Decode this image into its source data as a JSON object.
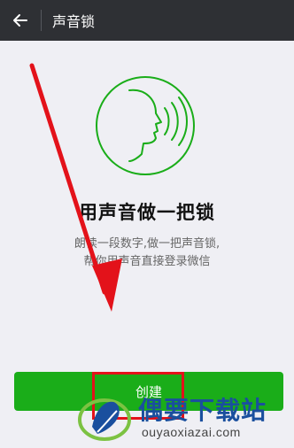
{
  "header": {
    "title": "声音锁",
    "back_icon": "arrow-left-icon"
  },
  "main": {
    "illustration_icon": "voice-face-icon",
    "heading": "用声音做一把锁",
    "description_line1": "朗读一段数字,做一把声音锁,",
    "description_line2": "帮你用声音直接登录微信",
    "create_button_label": "创建"
  },
  "watermark": {
    "brand": "偶要下载站",
    "url": "ouyaoxiazai.com"
  },
  "colors": {
    "topbar": "#2e3034",
    "background": "#efeff4",
    "primary_green": "#1aad19",
    "annotation_red": "#e3121a"
  }
}
